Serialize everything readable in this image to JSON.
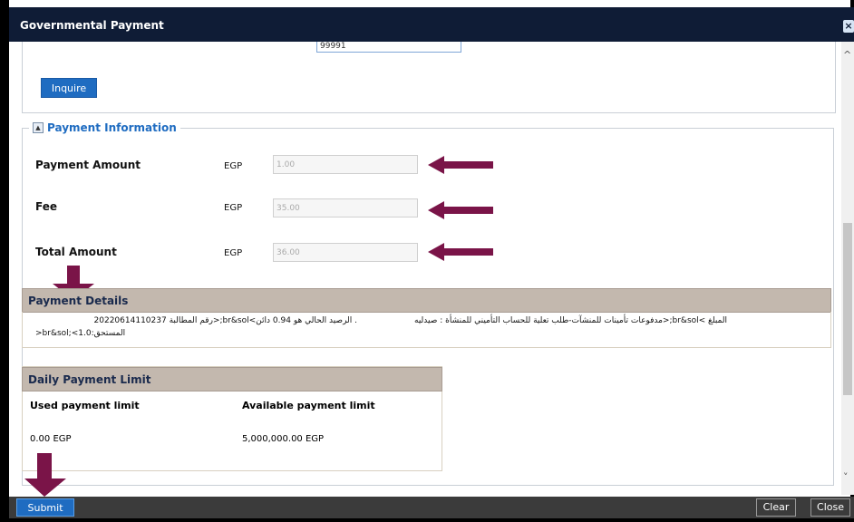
{
  "window": {
    "title": "Governmental Payment",
    "close_icon": "×"
  },
  "reference": {
    "value": "99991"
  },
  "inquire": {
    "label": "Inquire"
  },
  "payment_info": {
    "legend": "Payment Information",
    "toggle_icon": "▲",
    "rows": [
      {
        "label": "Payment Amount",
        "currency": "EGP",
        "value": "1.00"
      },
      {
        "label": "Fee",
        "currency": "EGP",
        "value": "35.00"
      },
      {
        "label": "Total Amount",
        "currency": "EGP",
        "value": "36.00"
      }
    ]
  },
  "payment_details": {
    "header": "Payment Details",
    "line1_right": "المبلغ >br&sol;<مدفوعات تأمينات للمنشآت-طلب تعلية للحساب التأميني للمنشأة : صيدليه",
    "line1_mid": ". الرصيد الحالي هو 0.94 دائن>br&sol;<رقم المطالبة 20220614110237",
    "line2": ">br&sol;<المستحق:1.0"
  },
  "daily_limit": {
    "header": "Daily Payment Limit",
    "used_label": "Used payment limit",
    "available_label": "Available payment limit",
    "used_value": "0.00 EGP",
    "available_value": "5,000,000.00 EGP"
  },
  "footer": {
    "submit": "Submit",
    "clear": "Clear",
    "close": "Close"
  },
  "colors": {
    "accent": "#1f6cc1",
    "title_bg": "#0f1c36",
    "arrow": "#7a1448",
    "section_header": "#c3b8ae"
  },
  "scrollbar": {
    "up_icon": "^",
    "down_icon": "˅"
  }
}
